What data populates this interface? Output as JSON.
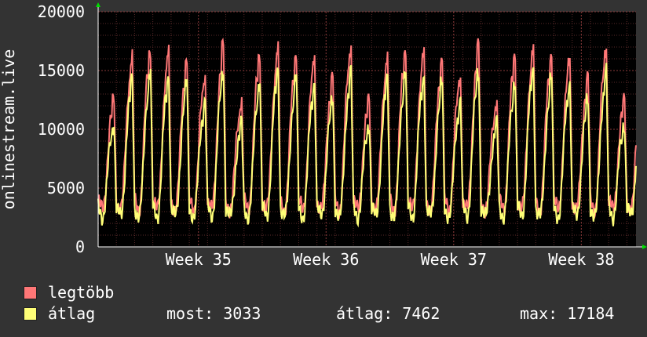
{
  "chart_data": {
    "type": "line",
    "ylabel": "onlinestream.live",
    "ylim": [
      0,
      20000
    ],
    "yticks": [
      0,
      5000,
      10000,
      15000,
      20000
    ],
    "ytick_labels": [
      "0",
      "5000",
      "10000",
      "15000",
      "20000"
    ],
    "x_tick_labels": [
      "Week 35",
      "Week 36",
      "Week 37",
      "Week 38"
    ],
    "grid": true,
    "background": "#000000",
    "grid_color": "#5a2a2a",
    "x_days": 29.5,
    "week_positions_days": [
      5.5,
      12.5,
      19.5,
      26.5
    ],
    "series": [
      {
        "name": "legtöbb",
        "color": "#ff7777",
        "weekday_peak": [
          12500,
          16200,
          16800,
          16500,
          16000,
          14500,
          17184
        ],
        "trough": 3200
      },
      {
        "name": "átlag",
        "color": "#ffff77",
        "weekday_peak": [
          10500,
          14200,
          15000,
          14500,
          14000,
          12500,
          15000
        ],
        "trough": 2600
      }
    ]
  },
  "legend": {
    "max_label": "legtöbb",
    "avg_label": "átlag",
    "now_text": "most: 3033",
    "avg_text": "átlag: 7462",
    "max_text": "max: 17184",
    "max_color": "#ff7777",
    "avg_color": "#ffff77"
  }
}
